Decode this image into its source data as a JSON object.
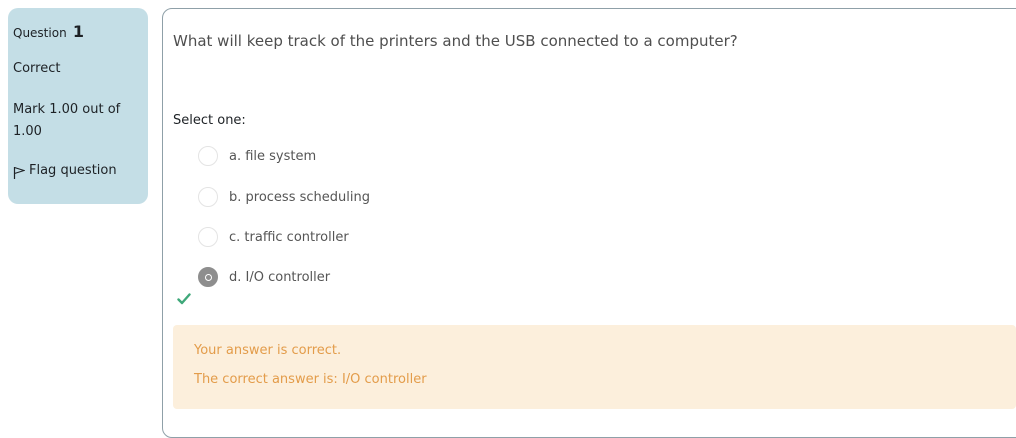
{
  "info": {
    "question_label": "Question",
    "question_number": "1",
    "state": "Correct",
    "grade": "Mark 1.00 out of 1.00",
    "flag_label": "Flag question"
  },
  "question": {
    "text": "What will keep track of the printers and the USB connected to a computer?",
    "prompt": "Select one:",
    "options": [
      {
        "label": "a. file system",
        "selected": false
      },
      {
        "label": "b. process scheduling",
        "selected": false
      },
      {
        "label": "c. traffic controller",
        "selected": false
      },
      {
        "label": "d. I/O controller",
        "selected": true
      }
    ]
  },
  "feedback": {
    "status": "Your answer is correct.",
    "right_answer": "The correct answer is: I/O controller"
  },
  "colors": {
    "info_bg": "#c4dee6",
    "feedback_bg": "#fcefdc",
    "feedback_text": "#e39c4a",
    "correct_check": "#3fa87a"
  },
  "icons": {
    "flag": "flag-icon",
    "correct": "checkmark-icon"
  }
}
